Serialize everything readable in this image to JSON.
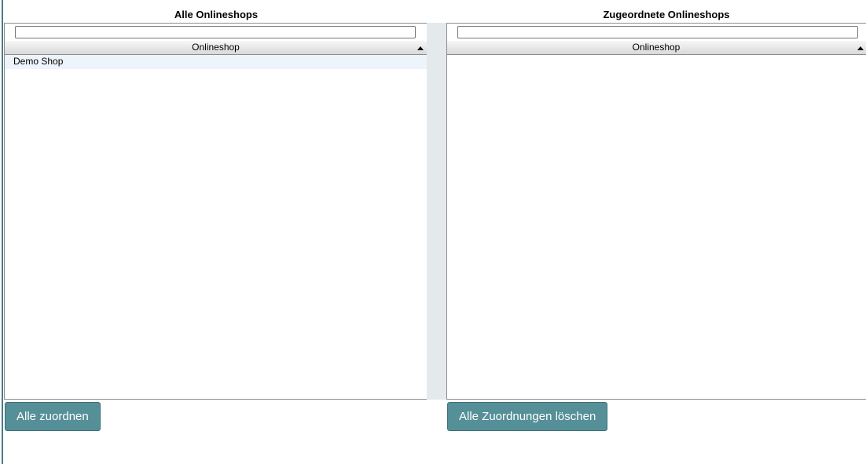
{
  "left_panel": {
    "title": "Alle Onlineshops",
    "filter_value": "",
    "column_header": "Onlineshop",
    "rows": [
      {
        "label": "Demo Shop"
      }
    ],
    "button_label": "Alle zuordnen"
  },
  "right_panel": {
    "title": "Zugeordnete Onlineshops",
    "filter_value": "",
    "column_header": "Onlineshop",
    "rows": [],
    "button_label": "Alle Zuordnungen löschen"
  },
  "colors": {
    "button_bg": "#558f97",
    "row_highlight": "#edf4fc",
    "gutter": "#e4e9ec"
  },
  "icons": {
    "sort": "sort-ascending-icon"
  }
}
